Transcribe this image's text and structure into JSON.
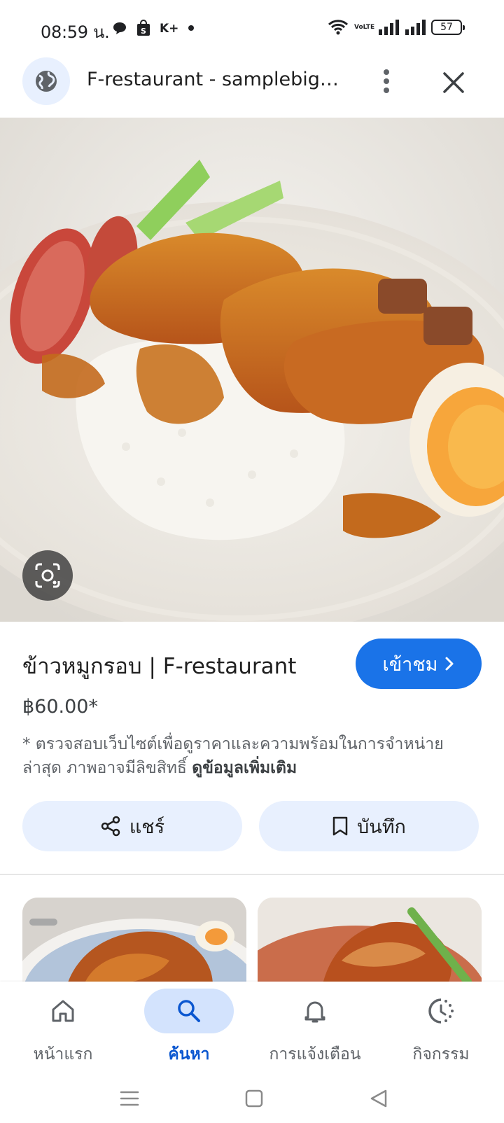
{
  "status_bar": {
    "time": "08:59 น.",
    "network_label": "VoLTE",
    "battery_level": "57"
  },
  "browser": {
    "title": "F-restaurant - samplebigb..."
  },
  "product": {
    "title": "ข้าวหมูกรอบ | F-restaurant",
    "visit_label": "เข้าชม",
    "price": "฿60.00*",
    "disclaimer": "* ตรวจสอบเว็บไซต์เพื่อดูราคาและความพร้อมในการจำหน่ายล่าสุด ภาพอาจมีลิขสิทธิ์",
    "more_info": "ดูข้อมูลเพิ่มเติม",
    "share_label": "แชร์",
    "save_label": "บันทึก"
  },
  "bottom_nav": {
    "items": [
      {
        "label": "หน้าแรก",
        "icon": "home-icon",
        "active": false
      },
      {
        "label": "ค้นหา",
        "icon": "search-icon",
        "active": true
      },
      {
        "label": "การแจ้งเตือน",
        "icon": "bell-icon",
        "active": false
      },
      {
        "label": "กิจกรรม",
        "icon": "activity-icon",
        "active": false
      }
    ]
  },
  "colors": {
    "accent": "#1a73e8",
    "pill": "#e8f0fe",
    "active_nav": "#d3e3fd"
  }
}
